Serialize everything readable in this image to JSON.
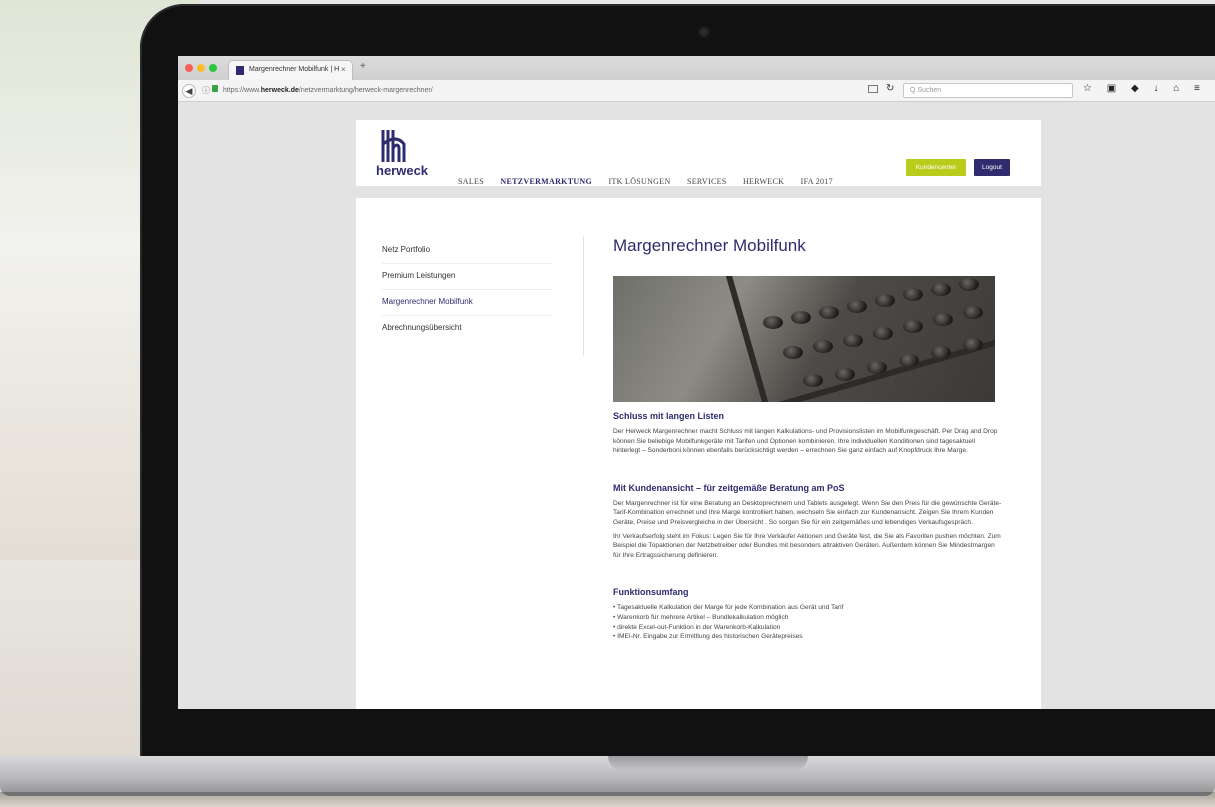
{
  "browser": {
    "tab_title": "Margenrechner Mobilfunk | H",
    "tab_close": "×",
    "new_tab": "+",
    "url_prefix": "https://www.",
    "url_domain": "herweck.de",
    "url_path": "/netzvermarktung/herweck-margenrechner/",
    "search_placeholder": "Q Suchen",
    "toolbar_icons": "☆ ▣ ◆ ↓ ⌂ ≡"
  },
  "site": {
    "logo_text": "herweck",
    "nav": [
      "SALES",
      "NETZVERMARKTUNG",
      "ITK LÖSUNGEN",
      "SERVICES",
      "HERWECK",
      "IFA 2017"
    ],
    "kundencenter_label": "Kundencenter",
    "logout_label": "Logout",
    "brand_color": "#2e2c6e",
    "accent_color": "#b9cc1c"
  },
  "sidenav": [
    "Netz Portfolio",
    "Premium Leistungen",
    "Margenrechner Mobilfunk",
    "Abrechnungsübersicht"
  ],
  "content": {
    "title": "Margenrechner Mobilfunk",
    "s1_heading": "Schluss mit langen Listen",
    "s1_text": "Der Herweck Margenrechner macht Schluss mit langen Kalkulations- und Provisionslisten im Mobilfunkgeschäft. Per Drag and Drop können Sie beliebige Mobilfunkgeräte mit Tarifen und Optionen kombinieren. Ihre individuellen Konditionen sind tagesaktuell hinterlegt – Sonderboni können ebenfalls berücksichtigt werden – errechnen Sie ganz einfach auf Knopfdruck Ihre Marge.",
    "s2_heading": "Mit Kundenansicht – für zeitgemäße Beratung am PoS",
    "s2_text1": "Der Margenrechner ist für eine Beratung an Desktoprechnern und Tablets ausgelegt. Wenn Sie den Preis für die gewünschte Geräte-Tarif-Kombination errechnet und Ihre Marge kontrolliert haben, wechseln Sie einfach zur Kundenansicht. Zeigen Sie Ihrem Kunden Geräte, Preise und Preisvergleiche in der Übersicht . So sorgen Sie für ein zeitgemäßes und lebendiges Verkaufsgespräch.",
    "s2_text2": "Ihr Verkaufserfolg steht im Fokus: Legen Sie für Ihre Verkäufer Aktionen und Geräte fest, die Sie als Favoriten pushen möchten. Zum Beispiel die Topaktionen der Netzbetreiber oder Bundles mit besonders attraktiven Geräten. Außerdem können Sie Mindestmargen für Ihre Ertragssicherung definieren.",
    "s3_heading": "Funktionsumfang",
    "s3_bullets": [
      "Tagesaktuelle Kalkulation der Marge für jede Kombination aus Gerät und Tarif",
      "Warenkorb für mehrere Artikel – Bundlekalkulation möglich",
      "direkte Excel-out-Funktion in der Warenkorb-Kalkulation",
      "IMEI-Nr. Eingabe zur Ermittlung des historischen Gerätepreises"
    ]
  }
}
